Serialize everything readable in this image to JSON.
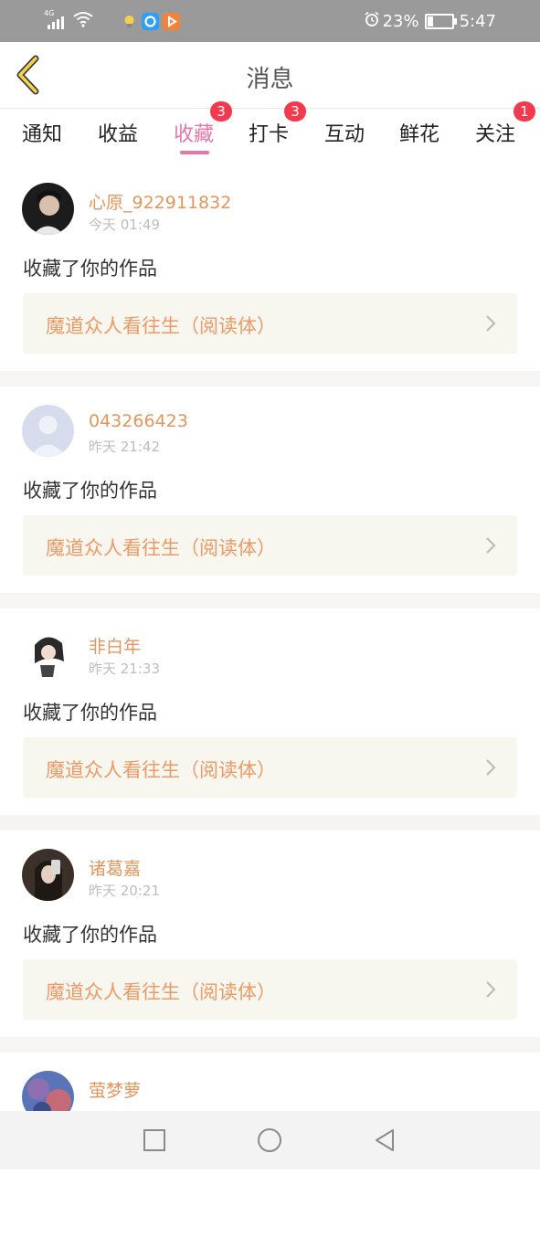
{
  "status_bar": {
    "network": "4G",
    "battery_percent": "23%",
    "battery_level": 0.23,
    "time": "5:47",
    "icons": [
      "signal-icon",
      "wifi-icon",
      "bulb-app-icon",
      "browser-app-icon",
      "video-app-icon",
      "alarm-icon",
      "battery-icon"
    ]
  },
  "header": {
    "title": "消息"
  },
  "tabs": [
    {
      "label": "通知",
      "badge": ""
    },
    {
      "label": "收益",
      "badge": ""
    },
    {
      "label": "收藏",
      "badge": "3",
      "active": true
    },
    {
      "label": "打卡",
      "badge": "3"
    },
    {
      "label": "互动",
      "badge": ""
    },
    {
      "label": "鲜花",
      "badge": ""
    },
    {
      "label": "关注",
      "badge": "1"
    }
  ],
  "messages": [
    {
      "user": "心原_922911832",
      "time": "今天 01:49",
      "action": "收藏了你的作品",
      "work": "魔道众人看往生（阅读体）"
    },
    {
      "user": "043266423",
      "time": "昨天 21:42",
      "action": "收藏了你的作品",
      "work": "魔道众人看往生（阅读体）"
    },
    {
      "user": "非白年",
      "time": "昨天 21:33",
      "action": "收藏了你的作品",
      "work": "魔道众人看往生（阅读体）"
    },
    {
      "user": "诸葛嘉",
      "time": "昨天 20:21",
      "action": "收藏了你的作品",
      "work": "魔道众人看往生（阅读体）"
    },
    {
      "user": "萤梦萝",
      "time": "",
      "action": "",
      "work": ""
    }
  ],
  "colors": {
    "accent": "#e676a8",
    "badge": "#f2394d",
    "username": "#e2965e",
    "work_title": "#ec9a66",
    "work_bg": "#f7f6ef"
  }
}
